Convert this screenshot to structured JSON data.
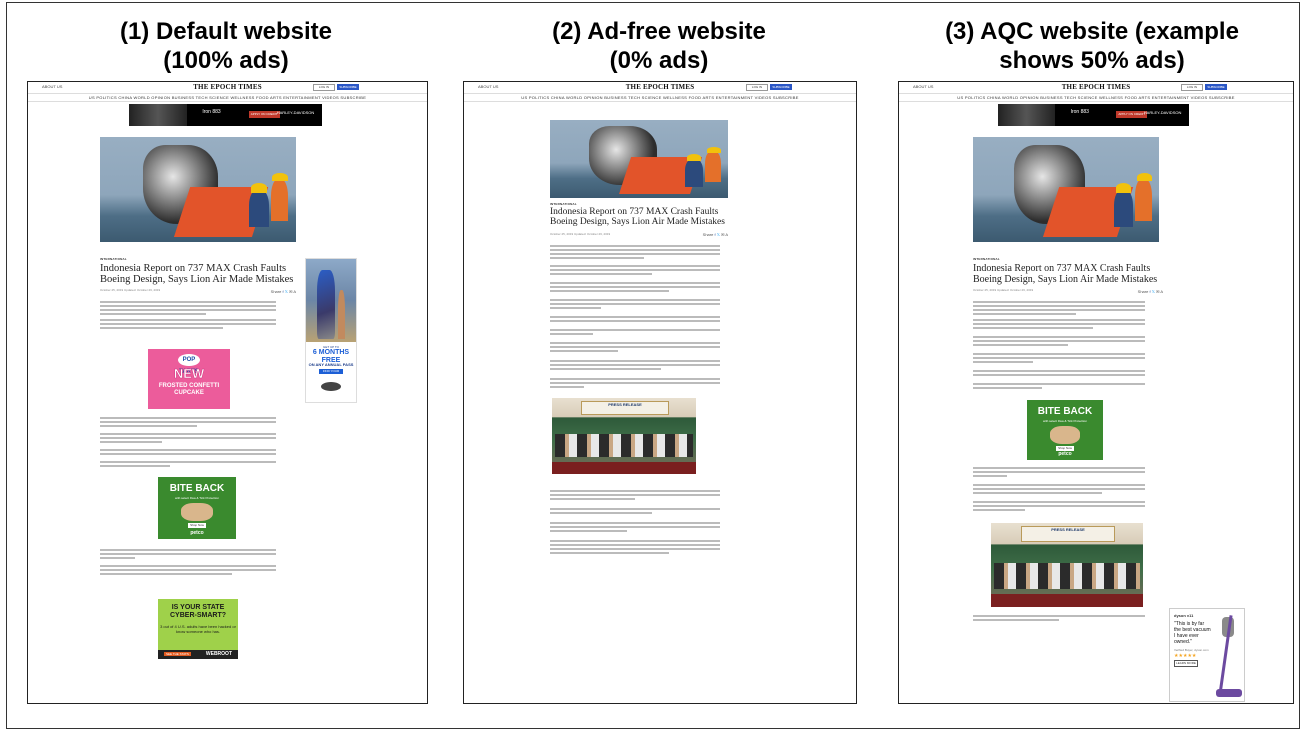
{
  "panels": [
    {
      "heading_line1": "(1) Default website",
      "heading_line2": "(100% ads)"
    },
    {
      "heading_line1": "(2) Ad-free website",
      "heading_line2": "(0% ads)"
    },
    {
      "heading_line1": "(3) AQC website (example",
      "heading_line2": "shows 50% ads)"
    }
  ],
  "site": {
    "logo": "THE EPOCH TIMES",
    "about": "ABOUT US",
    "login": "LOG IN",
    "subscribe": "SUBSCRIBE",
    "nav": "US  POLITICS  CHINA  WORLD  OPINION  BUSINESS  TECH  SCIENCE  WELLNESS  FOOD  ARTS  ENTERTAINMENT  VIDEOS  SUBSCRIBE"
  },
  "banner_ad": {
    "text": "Iron 883",
    "cta": "APPLY ON CREDIT",
    "brand": "HARLEY-DAVIDSON"
  },
  "article": {
    "kicker": "INTERNATIONAL",
    "title": "Indonesia Report on 737 MAX Crash Faults Boeing Design, Says Lion Air Made Mistakes",
    "byline": "October 25, 2019   Updated: October 26, 2019",
    "share": "Share"
  },
  "ads": {
    "pop": {
      "brand": "POP TARTS",
      "headline": "NEW",
      "line": "FROSTED CONFETTI CUPCAKE"
    },
    "petco": {
      "headline": "BITE BACK",
      "sub": "with select Flea & Tick Protection",
      "cta": "Shop Now",
      "brand": "petco"
    },
    "webroot": {
      "headline": "IS YOUR STATE CYBER-SMART?",
      "body": "3 out of 4 U.S. adults have been hacked or know someone who has.",
      "cta": "SEE THE STATS",
      "brand": "WEBROOT"
    },
    "universal": {
      "pre": "GET UP TO",
      "headline": "6 MONTHS FREE",
      "sub": "ON ANY ANNUAL PASS",
      "cta": "FIND YOUR PASS"
    },
    "dyson": {
      "brand": "dyson v11",
      "quote": "\"This is by far the best vacuum I have ever owned.\"",
      "source": "Verified Buyer, dyson.com",
      "stars": "★★★★★",
      "cta": "LEARN MORE"
    },
    "press": {
      "banner": "PRESS RELEASE"
    }
  }
}
